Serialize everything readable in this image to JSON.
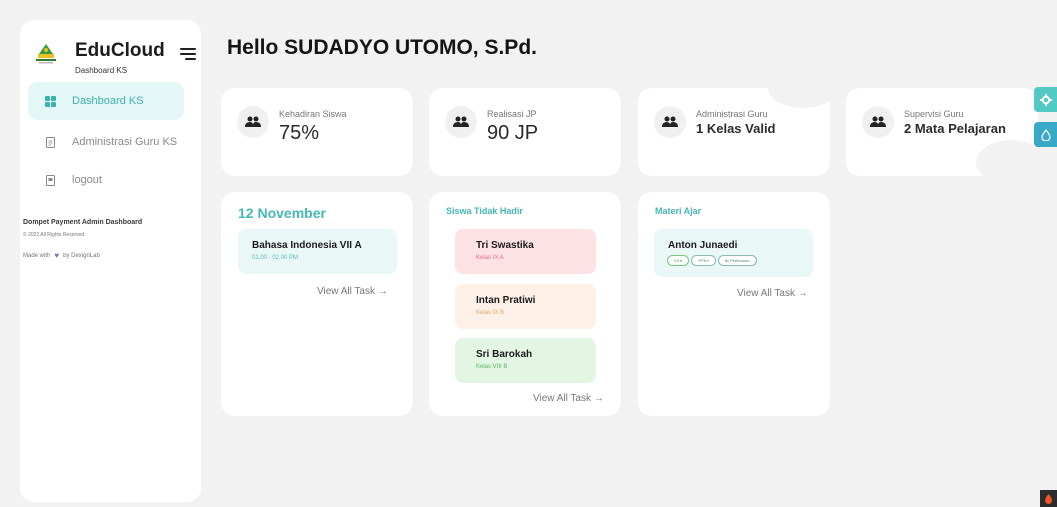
{
  "brand": {
    "name": "EduCloud",
    "subtitle": "Dashboard KS"
  },
  "sidebar": {
    "items": [
      {
        "label": "Dashboard KS",
        "icon": "grid-icon",
        "active": true
      },
      {
        "label": "Administrasi Guru KS",
        "icon": "document-icon",
        "active": false
      },
      {
        "label": "logout",
        "icon": "logout-icon",
        "active": false
      }
    ],
    "footer": {
      "title": "Dompet Payment Admin Dashboard",
      "copyright": "© 2022 All Rights Reserved",
      "made_with_prefix": "Made with",
      "made_with_suffix": "by DexignLab"
    }
  },
  "header": {
    "greeting": "Hello SUDADYO UTOMO, S.Pd."
  },
  "stats": [
    {
      "label": "Kehadiran Siswa",
      "value": "75%"
    },
    {
      "label": "Realisasi JP",
      "value": "90 JP"
    },
    {
      "label": "Administrasi Guru",
      "value": "1 Kelas Valid"
    },
    {
      "label": "Supervisi Guru",
      "value": "2 Mata Pelajaran"
    }
  ],
  "schedule": {
    "title": "12 November",
    "task": {
      "title": "Bahasa Indonesia VII A",
      "time": "01.00 - 02.00 PM"
    },
    "view_all": "View All Task →"
  },
  "absent": {
    "title": "Siswa Tidak Hadir",
    "students": [
      {
        "name": "Tri Swastika",
        "class": "Kelas IX A"
      },
      {
        "name": "Intan Pratiwi",
        "class": "Kelas IX B"
      },
      {
        "name": "Sri Barokah",
        "class": "Kelas VIII B"
      }
    ],
    "view_all": "View All Task →"
  },
  "materials": {
    "title": "Materi Ajar",
    "item": {
      "name": "Anton Junaedi",
      "tags": [
        "VII A",
        "PPKn",
        "8x Pertemuan"
      ]
    },
    "view_all": "View All Task →"
  },
  "colors": {
    "accent": "#44b8b4",
    "float_button_1": "#52c9c3",
    "float_button_2": "#3aa9c7",
    "absent_1": "#fde2e4",
    "absent_2": "#fdf0e6",
    "absent_3": "#e3f6e4"
  },
  "icons": {
    "settings": "gear-icon",
    "theme": "drop-icon",
    "corner": "flame-icon",
    "users": "users-icon"
  }
}
